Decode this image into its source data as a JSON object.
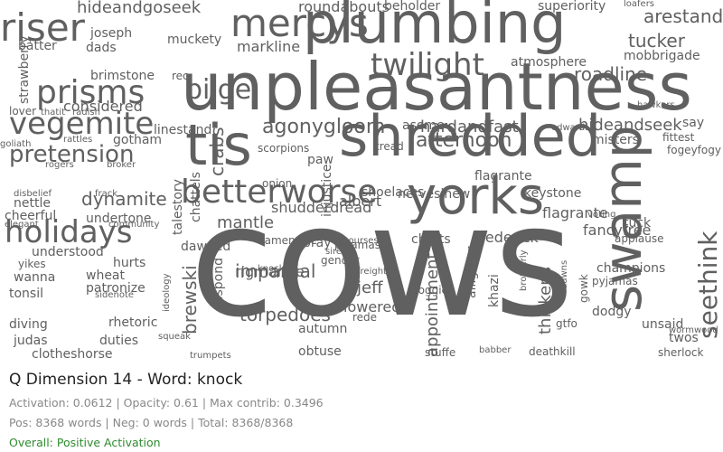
{
  "title": "Q Dimension 14 - Word: knock",
  "stats": {
    "line1": "Activation: 0.0612 | Opacity: 0.61 | Max contrib: 0.3496",
    "line2": "Pos: 8368 words | Neg: 0 words | Total: 8368/8368",
    "overall": "Overall: Positive Activation"
  },
  "colors": {
    "word": "#606060",
    "overall": "#2e8b2e",
    "title": "#222222",
    "stats": "#888888"
  },
  "words": [
    "cows",
    "unpleasantness",
    "plumbing",
    "shredded",
    "tis",
    "mercys",
    "swamp",
    "riser",
    "vegemite",
    "prisms",
    "yorks",
    "betterworse",
    "bilge",
    "twilight",
    "holidays",
    "pretension",
    "tucker",
    "seethink",
    "agonygloom",
    "crabs",
    "afternoon",
    "hardandfast",
    "roadline",
    "hideandseek",
    "impartial",
    "torpedoes",
    "rigmarole",
    "brewski",
    "dynamite",
    "appointment",
    "jeff",
    "thickens",
    "lowered",
    "mantle",
    "shudderdread",
    "albert",
    "frederick",
    "flagrante",
    "fancyfree",
    "charts",
    "nervesinew",
    "shoelaces",
    "keystone",
    "injustice",
    "talestory",
    "chattels",
    "undertone",
    "cheerful",
    "nettle",
    "disbelief",
    "understood",
    "wanna",
    "tonsil",
    "diving",
    "judas",
    "rhetoric",
    "duties",
    "clotheshorse",
    "patronize",
    "sidenote",
    "wheat",
    "hurts",
    "yikes",
    "obtuse",
    "autumn",
    "stuffe",
    "deathkill",
    "babber",
    "sherlock",
    "twos",
    "unsaid",
    "dodgy",
    "misters",
    "edward",
    "fittest",
    "say",
    "fogeyfogy",
    "hawkers",
    "mobbrigade",
    "atmosphere",
    "arestand",
    "loafers",
    "superiority",
    "beholder",
    "roundabouts",
    "hideandgoseek",
    "markline",
    "muckety",
    "rec",
    "brimstone",
    "considered",
    "lover",
    "gotham",
    "linestand",
    "asome",
    "tread",
    "paw",
    "scorpions",
    "onion",
    "bray",
    "namenoise",
    "dawned",
    "despond",
    "champions",
    "pyjamas",
    "knocks",
    "courses",
    "alligator",
    "gowk",
    "applause",
    "voting",
    "tuck",
    "strawberry",
    "batter",
    "dads",
    "joseph",
    "thatit",
    "radish",
    "rattles",
    "goliath",
    "rogers",
    "broker",
    "community",
    "elegant",
    "frack",
    "gender",
    "siree",
    "pajamas",
    "flagrante",
    "doggie",
    "rede",
    "ideology",
    "trumpets",
    "squeak",
    "wormwood",
    "khazi",
    "freight",
    "brotherly",
    "dawns",
    "gtfo"
  ]
}
